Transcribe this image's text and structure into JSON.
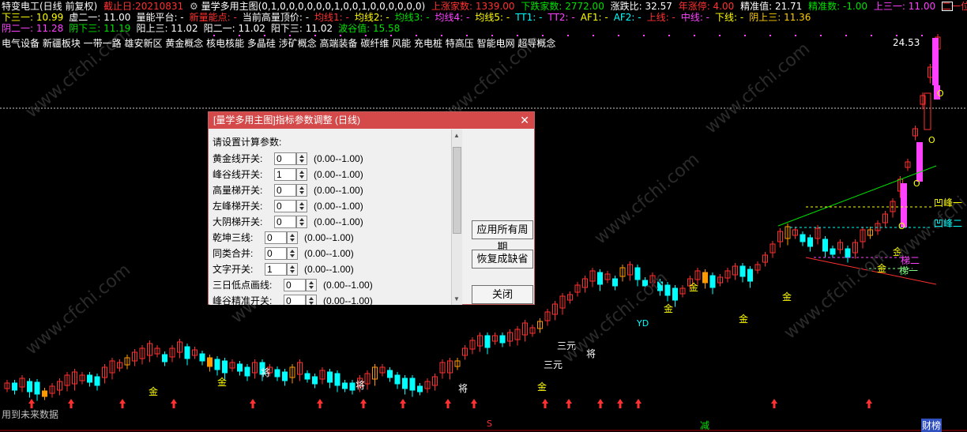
{
  "header": {
    "title": "特变电工(日线 前复权)",
    "cutoff_label": "截止日:20210831",
    "indicator_name": "量学多用主图(0,1,0,0,0,0,0,0,1,0,0,1,0,0,0,0,0,0)",
    "up_count": "上涨家数: 1339.00",
    "down_count": "下跌家数: 2772.00",
    "ratio": "涨跌比: 32.57",
    "limit_up_year": "年涨停: 4.00",
    "precise_value": "精准值: 21.71",
    "precise_count": "精准数: -1.00",
    "up3a": "上三一: 11.00",
    "two_pos": "二一位: 11.00",
    "row2": [
      {
        "text": "下三一: 10.99",
        "color": "yellow"
      },
      {
        "text": "虚二一: 11.00",
        "color": "white"
      },
      {
        "text": "量能平台: -",
        "color": "white"
      },
      {
        "text": "新量能点: -",
        "color": "red"
      },
      {
        "text": "当前高量顶价: -",
        "color": "white"
      },
      {
        "text": "均线1: -",
        "color": "red"
      },
      {
        "text": "均线2: -",
        "color": "yellow"
      },
      {
        "text": "均线3: -",
        "color": "green"
      },
      {
        "text": "均线4: -",
        "color": "magenta"
      },
      {
        "text": "均线5: -",
        "color": "yellow"
      },
      {
        "text": "TT1: -",
        "color": "cyan"
      },
      {
        "text": "TT2: -",
        "color": "magenta"
      },
      {
        "text": "AF1: -",
        "color": "yellow"
      },
      {
        "text": "AF2: -",
        "color": "cyan"
      },
      {
        "text": "上线: -",
        "color": "red"
      },
      {
        "text": "中线: -",
        "color": "magenta"
      },
      {
        "text": "下线: -",
        "color": "yellow"
      },
      {
        "text": "阴上三: 11.36",
        "color": "gold"
      }
    ],
    "row3": [
      {
        "text": "阴二一: 11.28",
        "color": "magenta"
      },
      {
        "text": "阴下三: 11.19",
        "color": "green"
      },
      {
        "text": "阳上三: 11.02",
        "color": "white"
      },
      {
        "text": "阳二一: 11.02",
        "color": "white"
      },
      {
        "text": "阳下三: 11.02",
        "color": "white"
      },
      {
        "text": "波谷值: 15.58",
        "color": "green"
      }
    ],
    "concepts": "电气设备 新疆板块 一带一路 雄安新区 黄金概念 核电核能 多晶硅 涉矿概念 高端装备 碳纤维 风能 充电桩 特高压 智能电网 超导概念"
  },
  "chart_labels": {
    "price_peak": "24.53",
    "peak1": "凹峰一",
    "peak2": "凹峰二",
    "ladder1": "梯一",
    "ladder2": "梯二",
    "gold": "金",
    "general": "将",
    "three_yuan": "三元",
    "yd": "YD",
    "o_mark": "O",
    "footer_text": "用到未来数据",
    "reduce": "减",
    "finance": "财榜",
    "s_mark": "S",
    "watermark": "www.cfchi.com",
    "colors": {
      "up": "#ff3030",
      "down": "#00ffff",
      "neutral": "#ffffff",
      "gold_bar": "#ff9900",
      "magenta_bar": "#ff40ff"
    }
  },
  "dialog": {
    "title": "[量学多用主图]指标参数调整 (日线)",
    "prompt": "请设置计算参数:",
    "params": [
      {
        "label": "黄金线开关:",
        "value": "0",
        "range": "(0.00--1.00)"
      },
      {
        "label": "峰谷线开关:",
        "value": "1",
        "range": "(0.00--1.00)"
      },
      {
        "label": "高量梯开关:",
        "value": "0",
        "range": "(0.00--1.00)"
      },
      {
        "label": "左峰梯开关:",
        "value": "0",
        "range": "(0.00--1.00)"
      },
      {
        "label": "大阴梯开关:",
        "value": "0",
        "range": "(0.00--1.00)"
      },
      {
        "label": "乾坤三线:",
        "value": "0",
        "range": "(0.00--1.00)"
      },
      {
        "label": "同类合并:",
        "value": "0",
        "range": "(0.00--1.00)"
      },
      {
        "label": "文字开关:",
        "value": "1",
        "range": "(0.00--1.00)"
      },
      {
        "label": "三日低点画线:",
        "value": "0",
        "range": "(0.00--1.00)"
      },
      {
        "label": "峰谷精准开关:",
        "value": "0",
        "range": "(0.00--1.00)"
      }
    ],
    "apply_all": "应用所有周期",
    "restore": "恢复成缺省",
    "close": "关闭"
  }
}
